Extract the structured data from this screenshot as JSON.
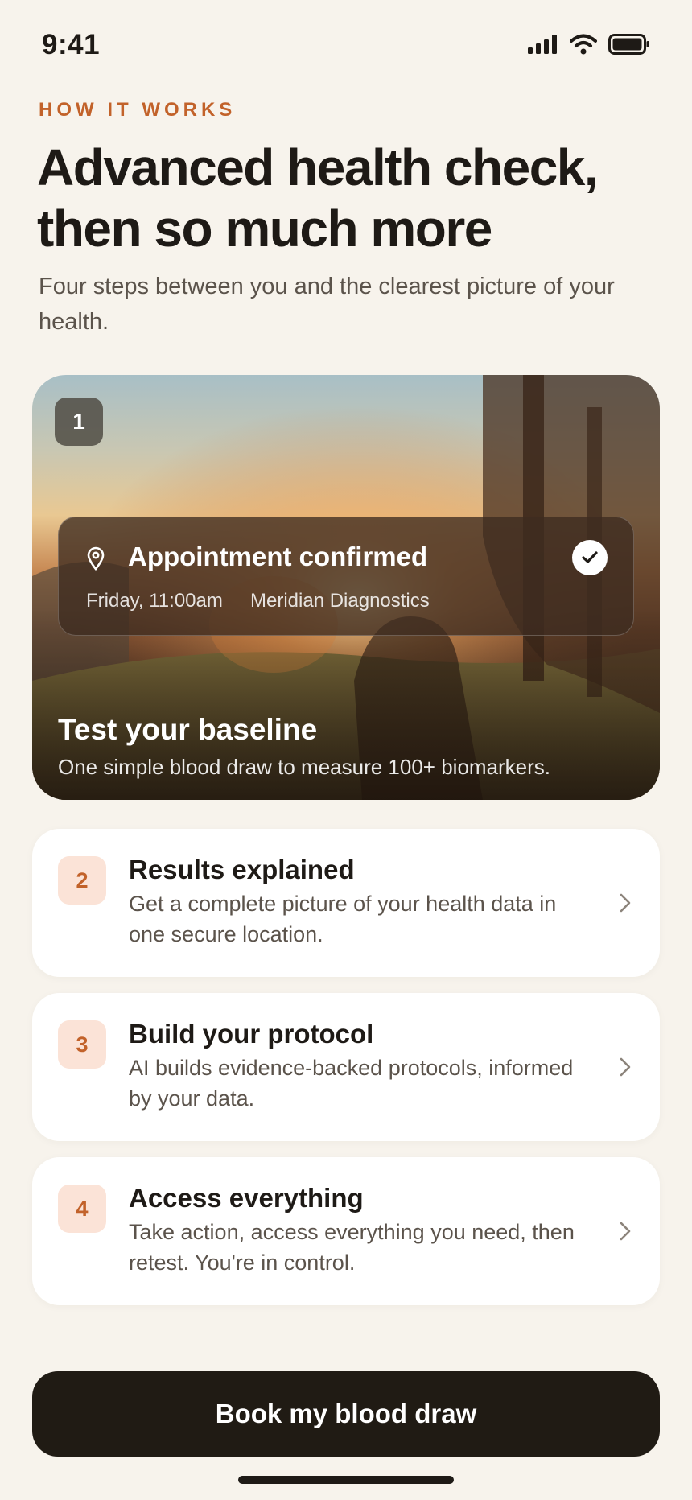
{
  "status_bar": {
    "time": "9:41"
  },
  "header": {
    "eyebrow": "HOW IT WORKS",
    "headline": "Advanced health check, then so much more",
    "subhead": "Four steps between you and the clearest picture of your health."
  },
  "hero": {
    "step_number": "1",
    "appointment": {
      "title": "Appointment confirmed",
      "when": "Friday, 11:00am",
      "where": "Meridian Diagnostics"
    },
    "title": "Test your baseline",
    "description": "One simple blood draw to measure 100+ biomarkers."
  },
  "steps": [
    {
      "number": "2",
      "title": "Results explained",
      "description": "Get a complete picture of your health data in one secure location."
    },
    {
      "number": "3",
      "title": "Build your protocol",
      "description": "AI builds evidence-backed protocols, informed by your data."
    },
    {
      "number": "4",
      "title": "Access everything",
      "description": "Take action, access everything you need, then retest. You're in control."
    }
  ],
  "cta": {
    "label": "Book my blood draw"
  },
  "colors": {
    "accent": "#C2622A",
    "background": "#F7F3EC",
    "cta": "#201B14",
    "chip": "#FBE3D7"
  },
  "icons": [
    "signal-icon",
    "wifi-icon",
    "battery-icon",
    "location-pin-icon",
    "check-icon",
    "chevron-right-icon"
  ]
}
